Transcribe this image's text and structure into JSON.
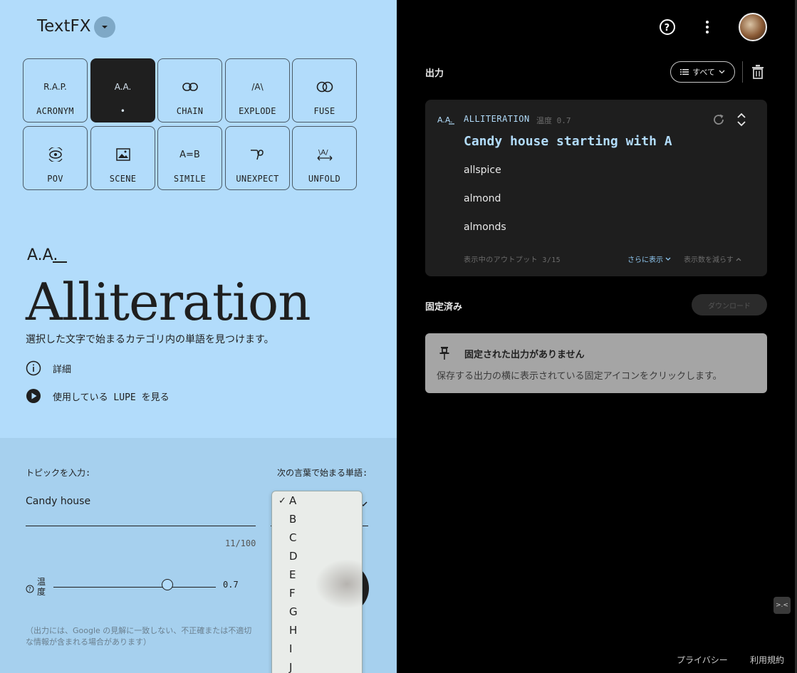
{
  "brand": {
    "name": "TextFX"
  },
  "tools": [
    {
      "id": "acronym",
      "icon_text": "R.A.P.",
      "label": "ACRONYM"
    },
    {
      "id": "alliteration",
      "icon_text": "A.A.",
      "label": "•"
    },
    {
      "id": "chain",
      "icon_text": "",
      "label": "CHAIN"
    },
    {
      "id": "explode",
      "icon_text": "/A\\",
      "label": "EXPLODE"
    },
    {
      "id": "fuse",
      "icon_text": "",
      "label": "FUSE"
    },
    {
      "id": "pov",
      "icon_text": "",
      "label": "POV"
    },
    {
      "id": "scene",
      "icon_text": "",
      "label": "SCENE"
    },
    {
      "id": "simile",
      "icon_text": "A=B",
      "label": "SIMILE"
    },
    {
      "id": "unexpect",
      "icon_text": "",
      "label": "UNEXPECT"
    },
    {
      "id": "unfold",
      "icon_text": "",
      "label": "UNFOLD"
    }
  ],
  "hero": {
    "icon_text": "A.A.",
    "title": "Alliteration",
    "description": "選択した文字で始まるカテゴリ内の単語を見つけます。",
    "detail_link": "詳細",
    "lupe_link": "使用している LUPE を見る"
  },
  "form": {
    "topic_label": "トピックを入力:",
    "topic_value": "Candy house",
    "counter": "11/100",
    "letter_label": "次の言葉で始まる単語:",
    "letters": [
      "A",
      "B",
      "C",
      "D",
      "E",
      "F",
      "G",
      "H",
      "I",
      "J"
    ],
    "selected_letter": "A",
    "temperature_label": "温度",
    "temperature_value": "0.7",
    "temperature_fraction": 0.7,
    "disclaimer": "（出力には、Google の見解に一致しない、不正確または不適切な情報が含まれる場合があります）"
  },
  "output": {
    "title": "出力",
    "filter_label": "すべて",
    "card": {
      "icon_text": "A.A.",
      "tool": "ALLITERATION",
      "temp": "温度 0.7",
      "prompt": "Candy house starting with A",
      "results": [
        "allspice",
        "almond",
        "almonds"
      ],
      "count_text": "表示中のアウトプット 3/15",
      "show_more": "さらに表示",
      "show_less": "表示数を減らす"
    }
  },
  "pinned": {
    "title": "固定済み",
    "download": "ダウンロード",
    "empty_title": "固定された出力がありません",
    "empty_desc": "保存する出力の横に表示されている固定アイコンをクリックします。"
  },
  "feedback_icon_text": ">.<",
  "footer": {
    "privacy": "プライバシー",
    "terms": "利用規約"
  },
  "colors": {
    "left_bg": "#b2dcfb",
    "accent": "#b2dcfb",
    "card_bg": "#1e1e1e"
  }
}
